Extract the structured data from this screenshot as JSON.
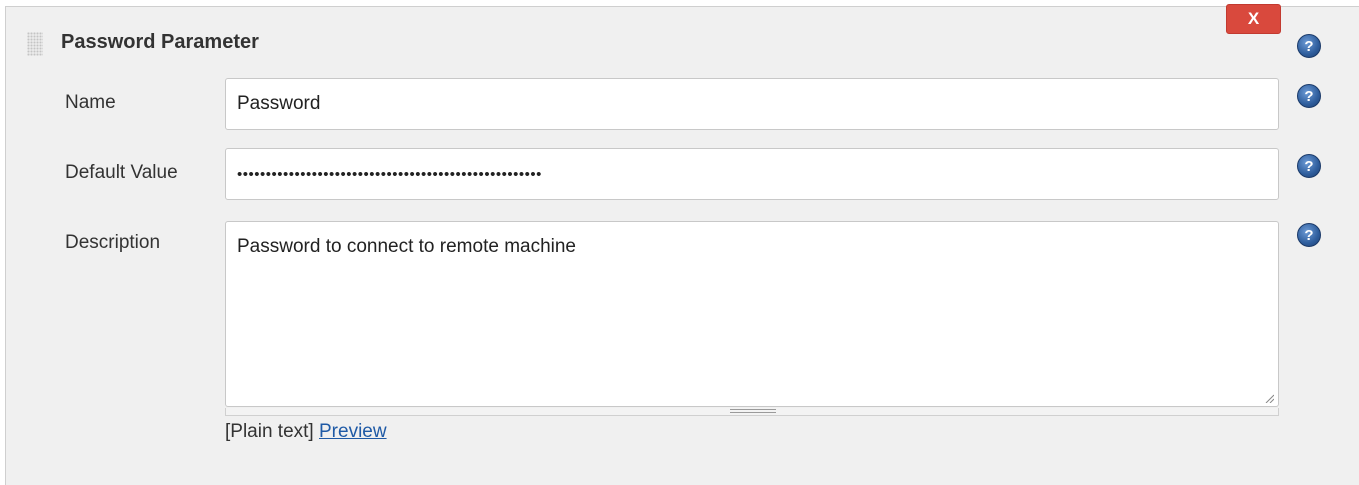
{
  "section": {
    "title": "Password Parameter",
    "delete_label": "X"
  },
  "fields": {
    "name": {
      "label": "Name",
      "value": "Password"
    },
    "default_value": {
      "label": "Default Value",
      "masked_value": "•••••••••••••••••••••••••••••••••••••••••••••••••••••"
    },
    "description": {
      "label": "Description",
      "value": "Password to connect to remote machine"
    }
  },
  "markup": {
    "format_text": "[Plain text]",
    "preview_label": "Preview"
  },
  "help_icon_glyph": "?",
  "colors": {
    "panel_bg": "#f0f0f0",
    "delete_button": "#d9493d",
    "help_icon": "#2e5d9c",
    "link": "#1f5aa6"
  }
}
